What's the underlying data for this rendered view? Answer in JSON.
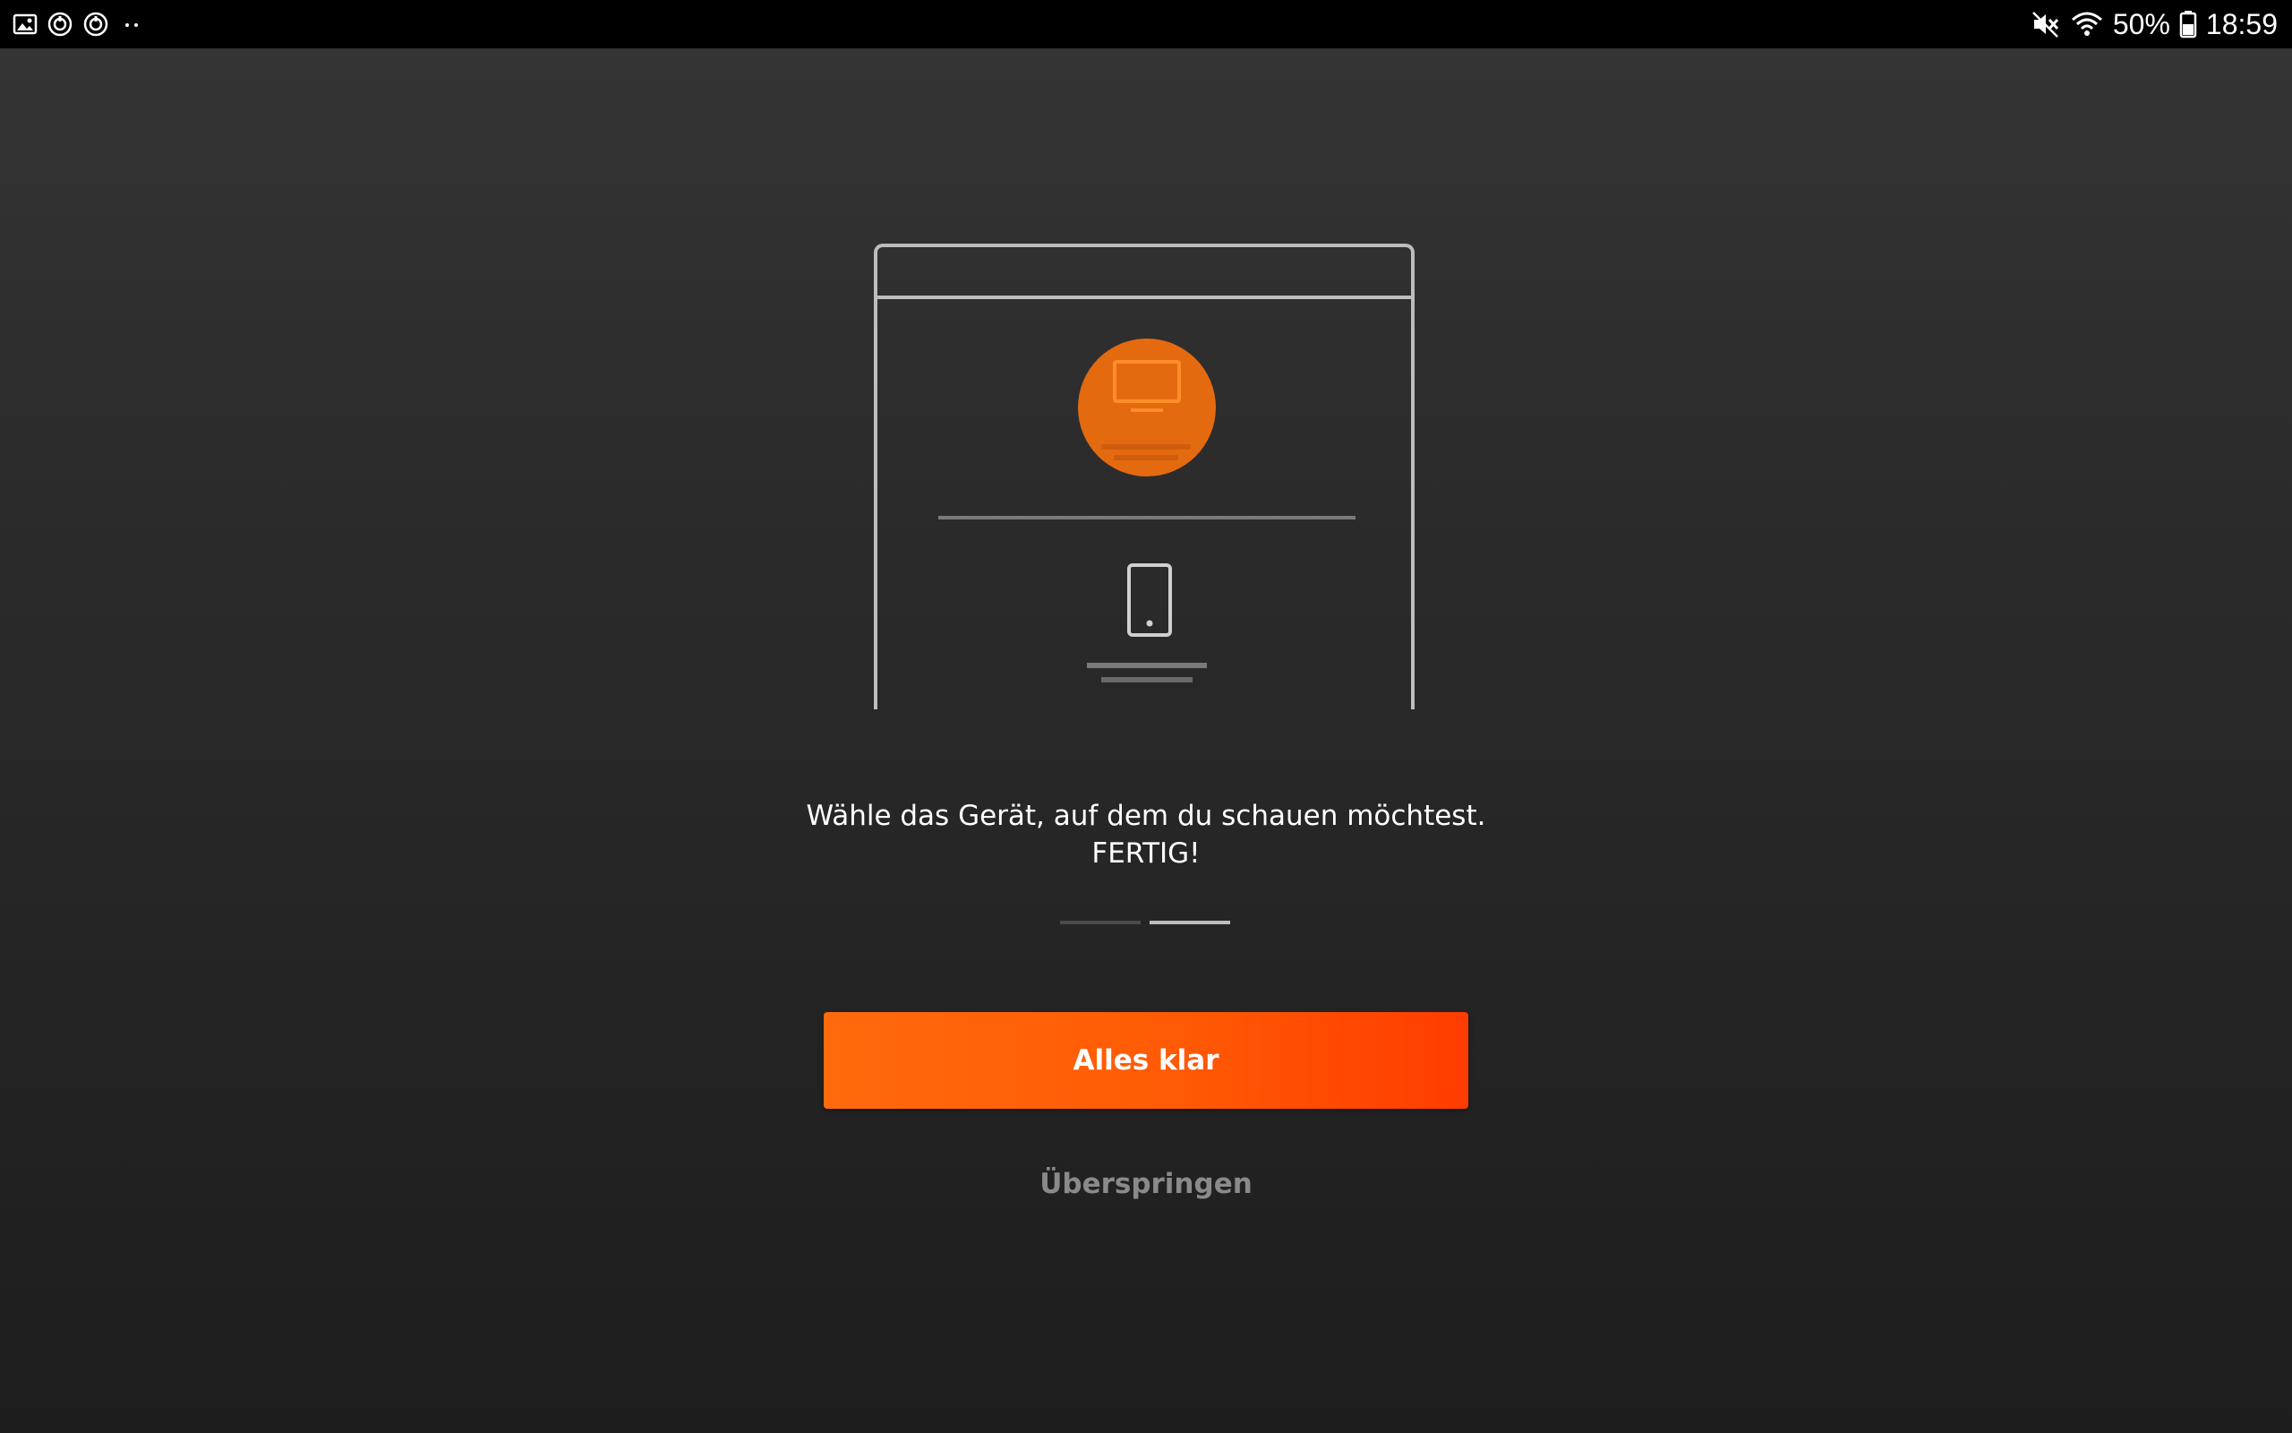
{
  "status_bar": {
    "battery_percent": "50%",
    "time": "18:59",
    "left_icons": [
      "gallery-icon",
      "sync-icon",
      "sync-icon",
      "more-dots-icon"
    ],
    "right_icons": [
      "mute-icon",
      "wifi-icon",
      "battery-icon"
    ]
  },
  "illustration": {
    "primary_icon": "tv-icon",
    "secondary_icon": "phone-icon",
    "accent_color": "#e46a10"
  },
  "message": {
    "line1": "Wähle das Gerät, auf dem du schauen möchtest.",
    "line2": "FERTIG!"
  },
  "pager": {
    "current_page": 2,
    "total_pages": 2
  },
  "actions": {
    "primary_label": "Alles klar",
    "skip_label": "Überspringen"
  },
  "colors": {
    "accent_start": "#ff6a0d",
    "accent_end": "#ff3c00",
    "background": "#2b2b2b"
  }
}
